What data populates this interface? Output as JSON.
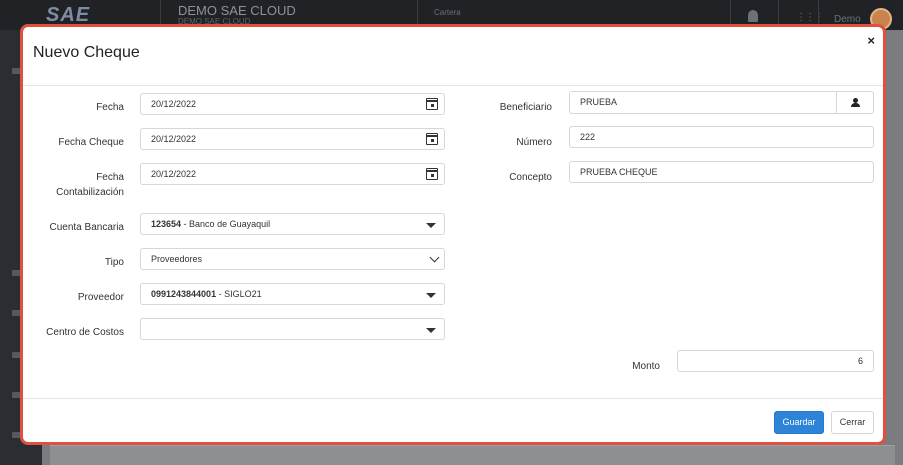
{
  "background": {
    "logo": "SAE",
    "company_title": "DEMO SAE CLOUD",
    "company_sub": "DEMO SAE CLOUD",
    "module_label": "Cartera",
    "user_label": "Demo"
  },
  "modal": {
    "title": "Nuevo Cheque",
    "close_symbol": "×",
    "left_fields": {
      "fecha": {
        "label": "Fecha",
        "value": "20/12/2022"
      },
      "fecha_cheque": {
        "label": "Fecha Cheque",
        "value": "20/12/2022"
      },
      "fecha_contabilizacion": {
        "label": "Fecha Contabilización",
        "value": "20/12/2022"
      },
      "cuenta_bancaria": {
        "label": "Cuenta Bancaria",
        "code": "123654",
        "name": " - Banco de Guayaquil"
      },
      "tipo": {
        "label": "Tipo",
        "value": "Proveedores"
      },
      "proveedor": {
        "label": "Proveedor",
        "code": "0991243844001",
        "name": " - SIGLO21"
      },
      "centro_costos": {
        "label": "Centro de Costos",
        "value": ""
      }
    },
    "right_fields": {
      "beneficiario": {
        "label": "Beneficiario",
        "value": "PRUEBA"
      },
      "numero": {
        "label": "Número",
        "value": "222"
      },
      "concepto": {
        "label": "Concepto",
        "value": "PRUEBA CHEQUE"
      },
      "monto": {
        "label": "Monto",
        "value": "6"
      }
    },
    "footer": {
      "save_label": "Guardar",
      "close_label": "Cerrar"
    }
  },
  "colors": {
    "accent": "#2c83d8",
    "modal_border": "#e0503e"
  }
}
